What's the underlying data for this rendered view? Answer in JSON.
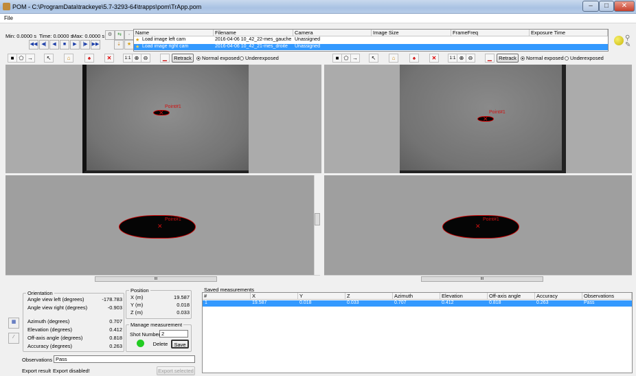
{
  "window": {
    "title": "POM - C:\\ProgramData\\trackeye\\5.7-3293-64\\trapps\\pom\\TrApp.pom",
    "menu": [
      "File"
    ]
  },
  "transport": {
    "min_label": "Min: 0.0000 s",
    "time_label": "Time: 0.0000 s",
    "max_label": "Max: 0.0000 s"
  },
  "camera_table": {
    "headers": [
      "Name",
      "Filename",
      "Camera",
      "Image Size",
      "FrameFreq",
      "Exposure Time"
    ],
    "rows": [
      {
        "name": "Load image left cam",
        "filename": "2016-04-06 10_42_22-mes_gauche",
        "camera": "Unassigned",
        "selected": false
      },
      {
        "name": "Load image right cam",
        "filename": "2016-04-06 10_42_21-mes_droite",
        "camera": "Unassigned",
        "selected": true
      }
    ]
  },
  "toolbar": {
    "zoom_label": "1:1",
    "retrack_label": "Retrack",
    "normal_exposed_label": "Normal exposed",
    "underexposed_label": "Underexposed"
  },
  "views": {
    "point_label": "Point#1",
    "scroll_thumb": "III"
  },
  "orientation": {
    "legend": "Orientation",
    "rows": [
      {
        "label": "Angle view left (degrees)",
        "value": "-178.783"
      },
      {
        "label": "Angle view right (degrees)",
        "value": "-0.903"
      },
      {
        "label": "Azimuth (degrees)",
        "value": "0.707"
      },
      {
        "label": "Elevation (degrees)",
        "value": "0.412"
      },
      {
        "label": "Off-axis angle (degrees)",
        "value": "0.818"
      },
      {
        "label": "Accuracy (degrees)",
        "value": "0.263"
      }
    ]
  },
  "position": {
    "legend": "Position",
    "rows": [
      {
        "label": "X (m)",
        "value": "19.587"
      },
      {
        "label": "Y (m)",
        "value": "0.018"
      },
      {
        "label": "Z (m)",
        "value": "0.033"
      }
    ]
  },
  "manage": {
    "legend": "Manage measurement",
    "shot_label": "Shot Number",
    "shot_value": "2",
    "delete_label": "Delete",
    "save_label": "Save"
  },
  "observations": {
    "label": "Observations",
    "value": "Pass"
  },
  "export": {
    "label": "Export result",
    "status": "Export disabled!",
    "button": "Export selected"
  },
  "saved": {
    "legend": "Saved measurements",
    "headers": [
      "#",
      "X",
      "Y",
      "Z",
      "Azimuth",
      "Elevation",
      "Off-axis angle",
      "Accuracy",
      "Observations"
    ],
    "rows": [
      {
        "n": "1",
        "x": "19.587",
        "y": "0.018",
        "z": "0.033",
        "az": "0.707",
        "el": "0.412",
        "off": "0.818",
        "acc": "0.263",
        "obs": "Pass"
      }
    ]
  },
  "colors": {
    "selection": "#3399ff",
    "point_red": "#d01010",
    "status_green": "#22cc22"
  }
}
